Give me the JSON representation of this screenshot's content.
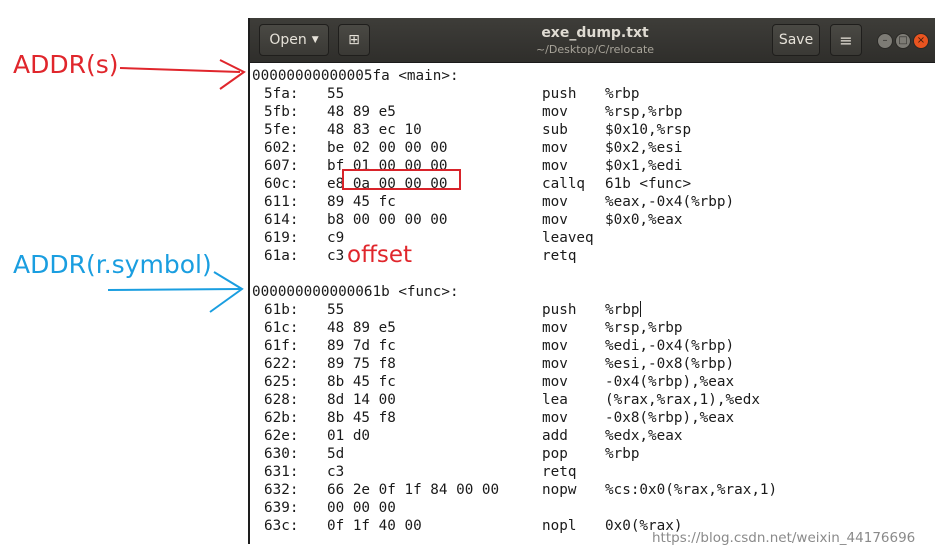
{
  "window": {
    "title": "exe_dump.txt",
    "subtitle": "~/Desktop/C/relocate",
    "open_label": "Open",
    "save_label": "Save",
    "menu_icon": "≡",
    "newtab_icon": "⊞"
  },
  "annotations": {
    "addr_s": "ADDR(s)",
    "addr_r_symbol": "ADDR(r.symbol)",
    "offset": "offset",
    "watermark": "https://blog.csdn.net/weixin_44176696",
    "red_color": "#e0262c",
    "blue_color": "#1a9ee0"
  },
  "dump": {
    "main_header": "00000000000005fa <main>:",
    "main_lines": [
      {
        "addr": "5fa:",
        "bytes": "55",
        "op": "push",
        "args": "%rbp"
      },
      {
        "addr": "5fb:",
        "bytes": "48 89 e5",
        "op": "mov",
        "args": "%rsp,%rbp"
      },
      {
        "addr": "5fe:",
        "bytes": "48 83 ec 10",
        "op": "sub",
        "args": "$0x10,%rsp"
      },
      {
        "addr": "602:",
        "bytes": "be 02 00 00 00",
        "op": "mov",
        "args": "$0x2,%esi"
      },
      {
        "addr": "607:",
        "bytes": "bf 01 00 00 00",
        "op": "mov",
        "args": "$0x1,%edi"
      },
      {
        "addr": "60c:",
        "bytes": "e8 0a 00 00 00",
        "op": "callq",
        "args": "61b <func>"
      },
      {
        "addr": "611:",
        "bytes": "89 45 fc",
        "op": "mov",
        "args": "%eax,-0x4(%rbp)"
      },
      {
        "addr": "614:",
        "bytes": "b8 00 00 00 00",
        "op": "mov",
        "args": "$0x0,%eax"
      },
      {
        "addr": "619:",
        "bytes": "c9",
        "op": "leaveq",
        "args": ""
      },
      {
        "addr": "61a:",
        "bytes": "c3",
        "op": "retq",
        "args": ""
      }
    ],
    "func_header": "000000000000061b <func>:",
    "func_lines": [
      {
        "addr": "61b:",
        "bytes": "55",
        "op": "push",
        "args": "%rbp"
      },
      {
        "addr": "61c:",
        "bytes": "48 89 e5",
        "op": "mov",
        "args": "%rsp,%rbp"
      },
      {
        "addr": "61f:",
        "bytes": "89 7d fc",
        "op": "mov",
        "args": "%edi,-0x4(%rbp)"
      },
      {
        "addr": "622:",
        "bytes": "89 75 f8",
        "op": "mov",
        "args": "%esi,-0x8(%rbp)"
      },
      {
        "addr": "625:",
        "bytes": "8b 45 fc",
        "op": "mov",
        "args": "-0x4(%rbp),%eax"
      },
      {
        "addr": "628:",
        "bytes": "8d 14 00",
        "op": "lea",
        "args": "(%rax,%rax,1),%edx"
      },
      {
        "addr": "62b:",
        "bytes": "8b 45 f8",
        "op": "mov",
        "args": "-0x8(%rbp),%eax"
      },
      {
        "addr": "62e:",
        "bytes": "01 d0",
        "op": "add",
        "args": "%edx,%eax"
      },
      {
        "addr": "630:",
        "bytes": "5d",
        "op": "pop",
        "args": "%rbp"
      },
      {
        "addr": "631:",
        "bytes": "c3",
        "op": "retq",
        "args": ""
      },
      {
        "addr": "632:",
        "bytes": "66 2e 0f 1f 84 00 00",
        "op": "nopw",
        "args": "%cs:0x0(%rax,%rax,1)"
      },
      {
        "addr": "639:",
        "bytes": "00 00 00",
        "op": "",
        "args": ""
      },
      {
        "addr": "63c:",
        "bytes": "0f 1f 40 00",
        "op": "nopl",
        "args": "0x0(%rax)"
      }
    ]
  }
}
